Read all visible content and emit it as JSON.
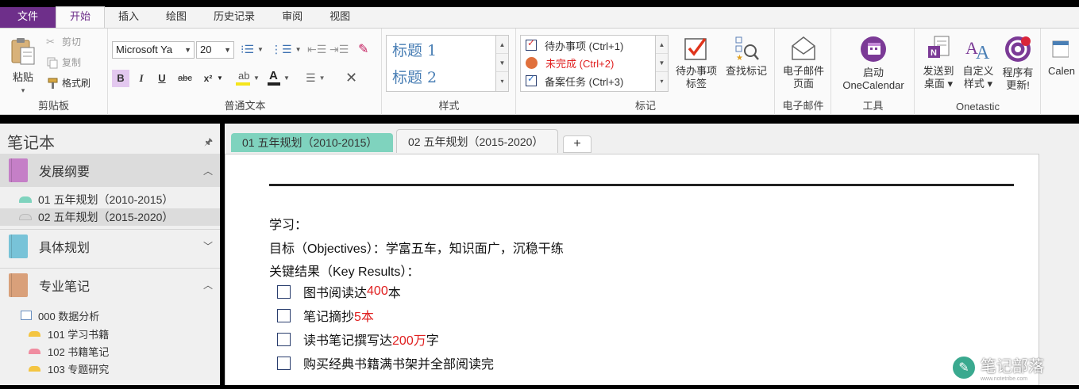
{
  "menu_tabs": [
    "文件",
    "开始",
    "插入",
    "绘图",
    "历史记录",
    "审阅",
    "视图"
  ],
  "ribbon": {
    "clipboard": {
      "paste": "粘贴",
      "cut": "剪切",
      "copy": "复制",
      "format_painter": "格式刷",
      "label": "剪贴板"
    },
    "basic_text": {
      "font_name": "Microsoft Ya",
      "font_size": "20",
      "bold": "B",
      "italic": "I",
      "underline": "U",
      "strike": "abc",
      "superscript": "x²",
      "label": "普通文本"
    },
    "styles": {
      "items": [
        "标题 1",
        "标题 2"
      ],
      "label": "样式"
    },
    "tags": {
      "items": [
        {
          "text": "待办事项 (Ctrl+1)",
          "color": "#333333"
        },
        {
          "text": "未完成 (Ctrl+2)",
          "color": "#e02020"
        },
        {
          "text": "备案任务 (Ctrl+3)",
          "color": "#333333"
        }
      ],
      "todo_tag_btn": [
        "待办事项",
        "标签"
      ],
      "find_tags_btn": "查找标记",
      "label": "标记"
    },
    "email": {
      "btn": [
        "电子邮件",
        "页面"
      ],
      "label": "电子邮件"
    },
    "tools": {
      "btn": [
        "启动",
        "OneCalendar"
      ],
      "label": "工具"
    },
    "onetastic": {
      "send": [
        "发送到",
        "桌面 ▾"
      ],
      "custom": [
        "自定义",
        "样式 ▾"
      ],
      "update": [
        "程序有",
        "更新!"
      ],
      "label": "Onetastic"
    },
    "calendar_partial": "Calen"
  },
  "nav": {
    "title": "笔记本",
    "groups": [
      {
        "label": "发展纲要",
        "color": "#c57fc7",
        "chev": "^"
      },
      {
        "label": "具体规划",
        "color": "#78c3d8",
        "chev": "v"
      },
      {
        "label": "专业笔记",
        "color": "#d9a07a",
        "chev": "^"
      }
    ],
    "sections": [
      {
        "label": "01 五年规划（2010-2015）",
        "color": "#7fd3be"
      },
      {
        "label": "02 五年规划（2015-2020）",
        "color": "#dcdcdc"
      }
    ],
    "sub": [
      {
        "label": "000 数据分析"
      },
      {
        "label": "101 学习书籍",
        "color": "#f4c542"
      },
      {
        "label": "102 书籍笔记",
        "color": "#f08ca0"
      },
      {
        "label": "103 专题研究",
        "color": "#f4c542"
      }
    ]
  },
  "section_tabs": [
    "01 五年规划（2010-2015）",
    "02 五年规划（2015-2020）",
    "+"
  ],
  "page": {
    "heading": "学习：",
    "objectives": "目标（Objectives）：学富五车，知识面广，沉稳干练",
    "key_results": "关键结果（Key Results）：",
    "todos": [
      {
        "pre": "图书阅读达",
        "num": "400",
        "post": "本"
      },
      {
        "pre": "笔记摘抄",
        "num": "5本",
        "post": ""
      },
      {
        "pre": "读书笔记撰写达",
        "num": "200万",
        "post": "字"
      },
      {
        "pre": "购买经典书籍满书架并全部阅读完",
        "num": "",
        "post": ""
      }
    ]
  },
  "watermark": {
    "main": "笔记部落",
    "sub": "www.notetribe.com"
  }
}
